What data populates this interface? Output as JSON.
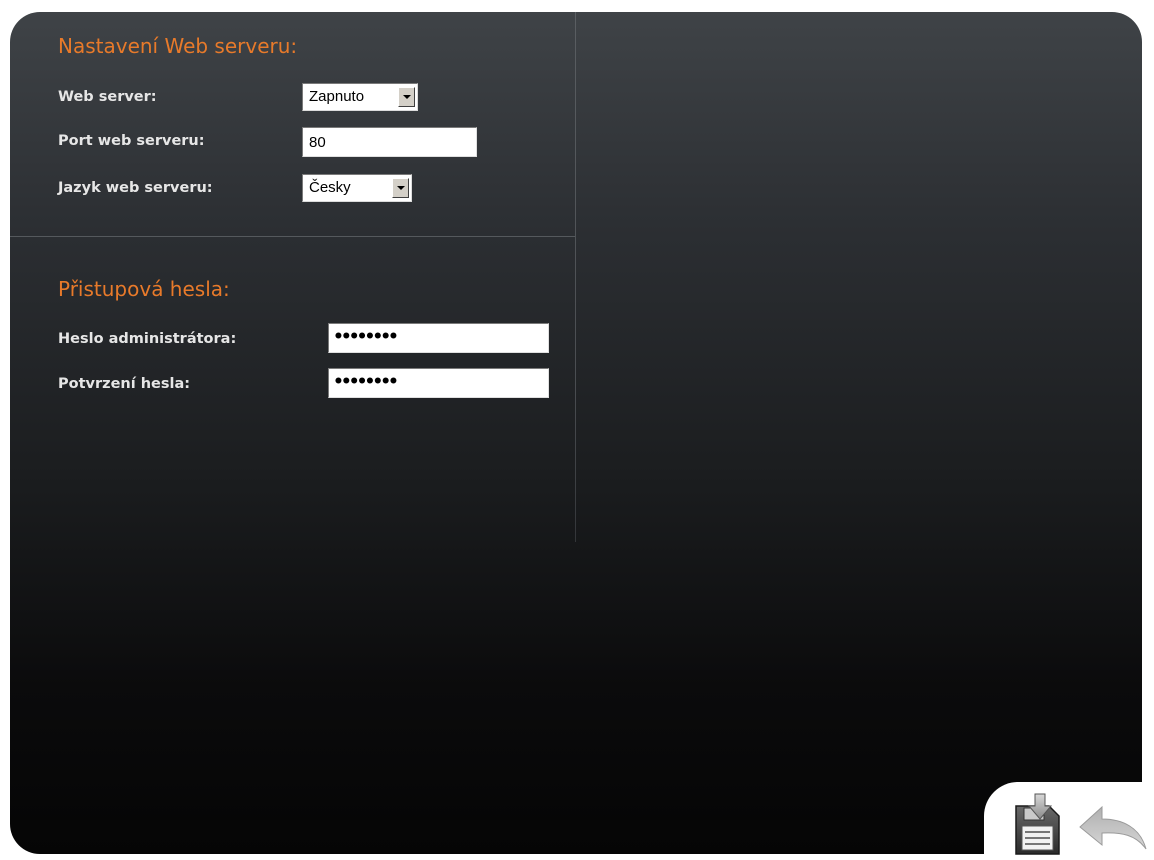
{
  "web_server_section": {
    "title": "Nastavení Web serveru:",
    "web_server_label": "Web server:",
    "web_server_value": "Zapnuto",
    "port_label": "Port web serveru:",
    "port_value": "80",
    "language_label": "Jazyk web serveru:",
    "language_value": "Česky"
  },
  "passwords_section": {
    "title": "Přistupová hesla:",
    "admin_password_label": "Heslo administrátora:",
    "admin_password_mask": "••••••••",
    "confirm_password_label": "Potvrzení hesla:",
    "confirm_password_mask": "••••••••"
  },
  "actions": {
    "save_icon": "save-floppy-icon",
    "back_icon": "back-arrow-icon"
  },
  "colors": {
    "accent_orange": "#e87a2a",
    "label_text": "#e6e6e6",
    "panel_top": "#3f4347",
    "panel_bottom": "#050505"
  }
}
